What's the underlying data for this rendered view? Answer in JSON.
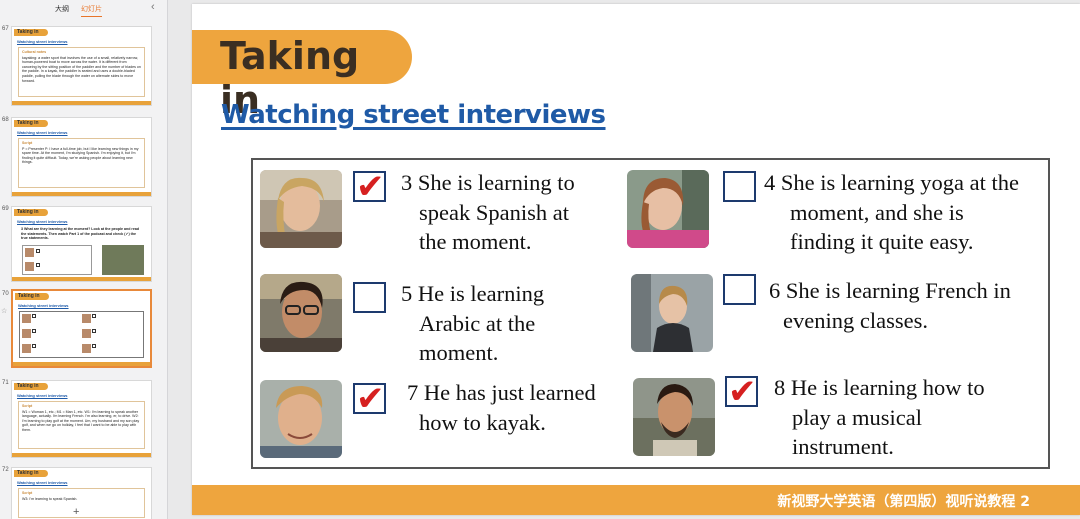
{
  "panel": {
    "tab_outline": "大纲",
    "tab_slides": "幻灯片",
    "thumbnails": [
      {
        "number": "67",
        "tag": "Taking in",
        "subtitle": "Watching street interviews",
        "box_title": "Cultural notes",
        "box_text": "kayaking: a water sport that involves the use of a small, relatively narrow, human-powered boat to move across the water. It is different from canoeing by the sitting position of the paddler and the number of blades on the paddle. In a kayak, the paddler is seated and uses a double-bladed paddle, pulling the blade through the water on alternate sides to move forward."
      },
      {
        "number": "68",
        "tag": "Taking in",
        "subtitle": "Watching street interviews",
        "box_title": "Script",
        "box_text": "P = Presenter  P: I have a full-time job, but I like learning new things in my spare time. At the moment, I'm studying Spanish. I'm enjoying it, but I'm finding it quite difficult. Today, we're asking people about learning new things."
      },
      {
        "number": "69",
        "tag": "Taking in",
        "subtitle": "Watching street interviews",
        "box_title": "",
        "box_text": "3 What are they learning at the moment? Look at the people and read the statements. Then watch Part 1 of the podcast and check (✔) the true statements."
      },
      {
        "number": "70",
        "tag": "Taking in",
        "subtitle": "Watching street interviews",
        "box_title": "",
        "box_text": ""
      },
      {
        "number": "71",
        "tag": "Taking in",
        "subtitle": "Watching street interviews",
        "box_title": "Script",
        "box_text": "W1 = Woman 1, etc.; M1 = Man 1, etc. W1: I'm learning to speak another language, actually. I'm learning French. I'm also learning, er, to drive. W2: I'm learning to play golf at the moment. Um, my husband and my son play golf, and when we go on holiday, I feel that I want to be able to play with them."
      },
      {
        "number": "72",
        "tag": "Taking in",
        "subtitle": "Watching street interviews",
        "box_title": "Script",
        "box_text": "W3: I'm learning to speak Spanish."
      }
    ],
    "add_label": "+"
  },
  "slide": {
    "title": "Taking in",
    "subtitle": "Watching street interviews",
    "footer": "新视野大学英语（第四版）视听说教程 2",
    "items": [
      {
        "number": "3",
        "lines": [
          "3 She is learning to",
          "speak Spanish at",
          "the moment."
        ],
        "checked": true
      },
      {
        "number": "4",
        "lines": [
          "4 She is learning yoga at the",
          "moment, and she is",
          "finding it quite easy."
        ],
        "checked": false
      },
      {
        "number": "5",
        "lines": [
          "5 He is learning",
          "Arabic at the",
          "moment."
        ],
        "checked": false
      },
      {
        "number": "6",
        "lines": [
          "6 She is learning French in",
          "evening classes."
        ],
        "checked": false
      },
      {
        "number": "7",
        "lines": [
          "7 He has just learned",
          "how to kayak."
        ],
        "checked": true
      },
      {
        "number": "8",
        "lines": [
          "8 He is learning how to",
          "play a musical",
          "instrument."
        ],
        "checked": true
      }
    ],
    "tick_glyph": "✔"
  },
  "colors": {
    "accent": "#eea53e",
    "link_blue": "#1f5aa6",
    "tick_red": "#d62020"
  }
}
